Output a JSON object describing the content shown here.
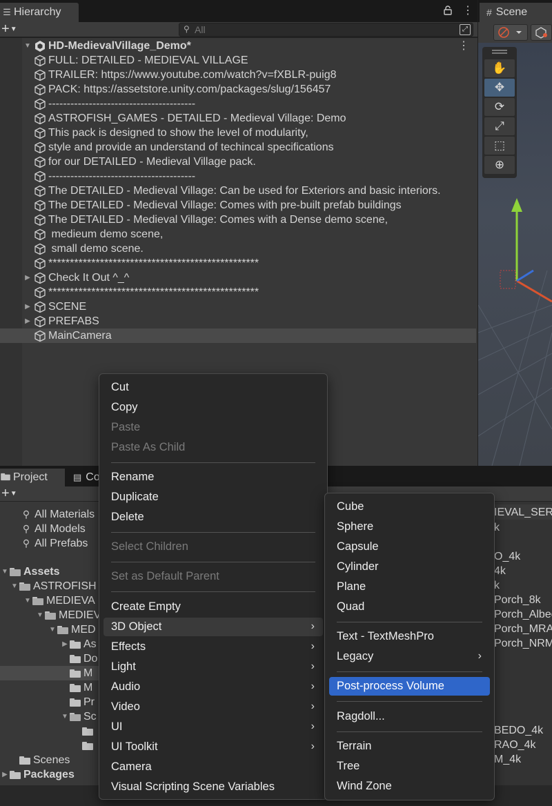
{
  "hierarchy": {
    "tab_label": "Hierarchy",
    "search_placeholder": "All",
    "root_label": "HD-MedievalVillage_Demo*",
    "items": [
      {
        "label": "FULL: DETAILED - MEDIEVAL VILLAGE"
      },
      {
        "label": "TRAILER: https://www.youtube.com/watch?v=fXBLR-puig8"
      },
      {
        "label": "PACK: https://assetstore.unity.com/packages/slug/156457"
      },
      {
        "label": "----------------------------------------"
      },
      {
        "label": "ASTROFISH_GAMES - DETAILED - Medieval Village: Demo"
      },
      {
        "label": "This pack is designed to show the level of modularity,"
      },
      {
        "label": "style and provide an understand of techincal specifications"
      },
      {
        "label": "for our DETAILED - Medieval Village pack."
      },
      {
        "label": "----------------------------------------"
      },
      {
        "label": "The DETAILED - Medieval Village: Can be used for Exteriors and basic interiors."
      },
      {
        "label": "The DETAILED - Medieval Village: Comes with pre-built prefab buildings"
      },
      {
        "label": "The DETAILED - Medieval Village: Comes with a Dense demo scene,"
      },
      {
        "label": " medieum demo scene,"
      },
      {
        "label": " small demo scene."
      },
      {
        "label": "*************************************************"
      },
      {
        "label": "Check It Out ^_^"
      },
      {
        "label": "*************************************************"
      },
      {
        "label": "SCENE"
      },
      {
        "label": "PREFABS"
      },
      {
        "label": "MainCamera"
      }
    ]
  },
  "scene": {
    "tab_label": "Scene"
  },
  "project": {
    "tab_label": "Project",
    "console_tab_label": "Co",
    "favorites": [
      {
        "label": "All Materials"
      },
      {
        "label": "All Models"
      },
      {
        "label": "All Prefabs"
      }
    ],
    "tree": [
      {
        "label": "Assets"
      },
      {
        "label": "ASTROFISH"
      },
      {
        "label": "MEDIEVA"
      },
      {
        "label": "MEDIEV"
      },
      {
        "label": "MED"
      },
      {
        "label": "As"
      },
      {
        "label": "Do"
      },
      {
        "label": "M"
      },
      {
        "label": "M"
      },
      {
        "label": "Pr"
      },
      {
        "label": "Sc"
      },
      {
        "label": ""
      },
      {
        "label": ""
      },
      {
        "label": "Scenes"
      },
      {
        "label": "Packages"
      }
    ],
    "right_files": [
      {
        "label": "IEVAL_SER"
      },
      {
        "label": "k"
      },
      {
        "label": "O_4k"
      },
      {
        "label": "4k"
      },
      {
        "label": "k"
      },
      {
        "label": "Porch_8k"
      },
      {
        "label": "Porch_Albec"
      },
      {
        "label": "Porch_MRAC"
      },
      {
        "label": "Porch_NRM_"
      },
      {
        "label": "BEDO_4k"
      },
      {
        "label": "RAO_4k"
      },
      {
        "label": "M_4k"
      }
    ]
  },
  "context_menu": {
    "items": [
      {
        "label": "Cut"
      },
      {
        "label": "Copy"
      },
      {
        "label": "Paste"
      },
      {
        "label": "Paste As Child"
      },
      {
        "label": "Rename"
      },
      {
        "label": "Duplicate"
      },
      {
        "label": "Delete"
      },
      {
        "label": "Select Children"
      },
      {
        "label": "Set as Default Parent"
      },
      {
        "label": "Create Empty"
      },
      {
        "label": "3D Object"
      },
      {
        "label": "Effects"
      },
      {
        "label": "Light"
      },
      {
        "label": "Audio"
      },
      {
        "label": "Video"
      },
      {
        "label": "UI"
      },
      {
        "label": "UI Toolkit"
      },
      {
        "label": "Camera"
      },
      {
        "label": "Visual Scripting Scene Variables"
      }
    ]
  },
  "submenu_3d_object": {
    "items": [
      {
        "label": "Cube"
      },
      {
        "label": "Sphere"
      },
      {
        "label": "Capsule"
      },
      {
        "label": "Cylinder"
      },
      {
        "label": "Plane"
      },
      {
        "label": "Quad"
      },
      {
        "label": "Text - TextMeshPro"
      },
      {
        "label": "Legacy"
      },
      {
        "label": "Post-process Volume"
      },
      {
        "label": "Ragdoll..."
      },
      {
        "label": "Terrain"
      },
      {
        "label": "Tree"
      },
      {
        "label": "Wind Zone"
      }
    ]
  },
  "colors": {
    "highlight": "#2f66c9",
    "panel": "#383838",
    "menu_bg": "#282828"
  }
}
